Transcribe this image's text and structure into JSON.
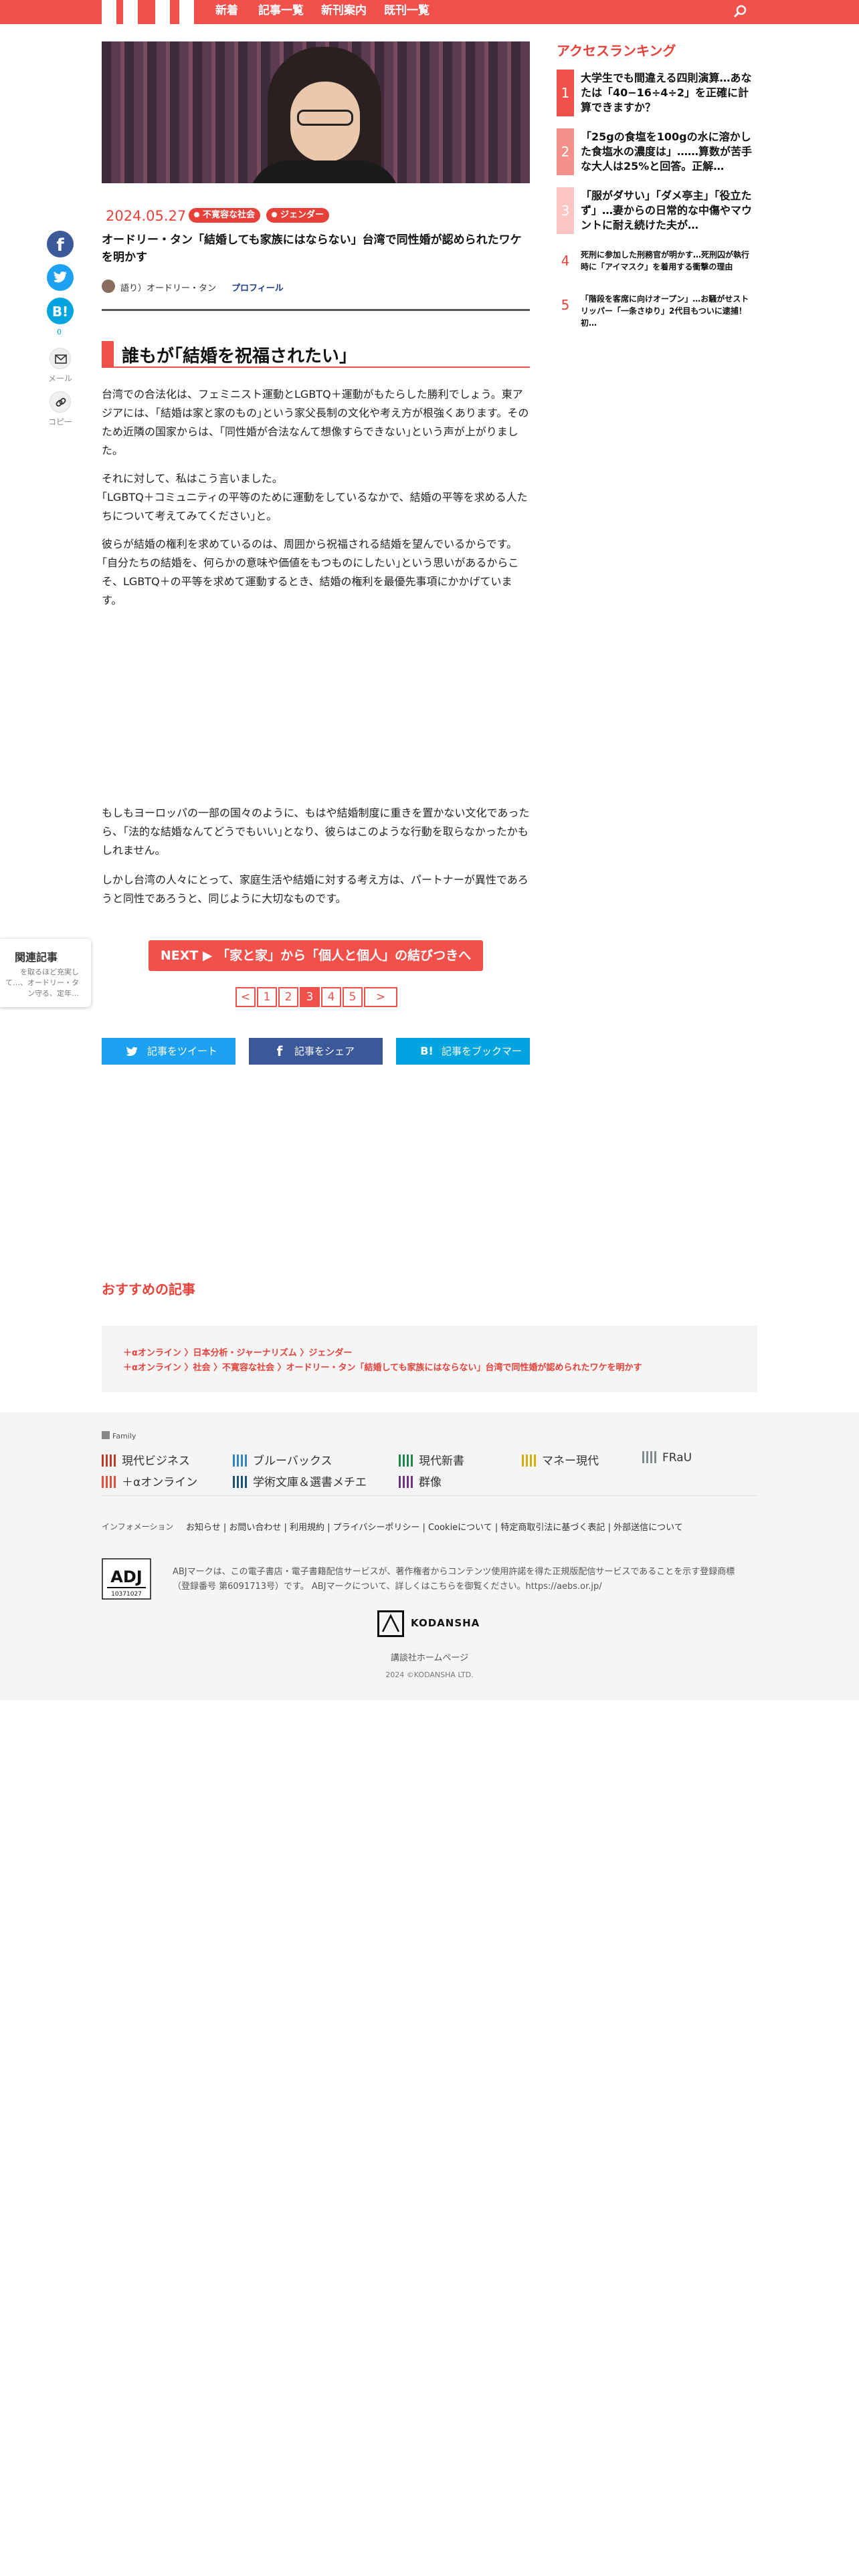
{
  "header": {
    "nav": [
      "新着",
      "記事一覧",
      "新刊案内",
      "既刊一覧"
    ]
  },
  "share_rail": {
    "hatena_count": "0",
    "mail_label": "メール",
    "copy_label": "コピー"
  },
  "related": {
    "title": "関連記事",
    "text": "を取るほど充実して…、オードリー・タン守る、定年…"
  },
  "article": {
    "date": "2024.05.27",
    "tags": [
      "不寛容な社会",
      "ジェンダー"
    ],
    "title": "オードリー・タン「結婚しても家族にはならない」台湾で同性婚が認められたワケを明かす",
    "author": "語り）オードリー・タン",
    "profile_label": "プロフィール",
    "heading": "誰もが｢結婚を祝福されたい｣",
    "paragraphs": [
      "台湾での合法化は、フェミニスト運動とLGBTQ＋運動がもたらした勝利でしょう。東アジアには、｢結婚は家と家のもの｣という家父長制の文化や考え方が根強くあります。そのため近隣の国家からは、｢同性婚が合法なんて想像すらできない｣という声が上がりました。",
      "それに対して、私はこう言いました。\n｢LGBTQ＋コミュニティの平等のために運動をしているなかで、結婚の平等を求める人たちについて考えてみてください｣と。",
      "彼らが結婚の権利を求めているのは、周囲から祝福される結婚を望んでいるからです。｢自分たちの結婚を、何らかの意味や価値をもつものにしたい｣という思いがあるからこそ、LGBTQ＋の平等を求めて運動するとき、結婚の権利を最優先事項にかかげています。",
      "もしもヨーロッパの一部の国々のように、もはや結婚制度に重きを置かない文化であったら、｢法的な結婚なんてどうでもいい｣となり、彼らはこのような行動を取らなかったかもしれません。",
      "しかし台湾の人々にとって、家庭生活や結婚に対する考え方は、パートナーが異性であろうと同性であろうと、同じように大切なものです。"
    ]
  },
  "next": {
    "label": "NEXT ▶ 「家と家」から「個人と個人」の結びつきへ"
  },
  "pagination": {
    "prev": "<",
    "pages": [
      "1",
      "2",
      "3",
      "4",
      "5"
    ],
    "current": "3",
    "next": ">"
  },
  "social": {
    "tweet": "記事をツイート",
    "share": "記事をシェア",
    "bookmark": "記事をブックマーク"
  },
  "recommended_heading": "おすすめの記事",
  "breadcrumbs": {
    "line1": "＋αオンライン 〉日本分析・ジャーナリズム 〉ジェンダー",
    "line2": "＋αオンライン 〉社会 〉不寛容な社会 〉オードリー・タン「結婚しても家族にはならない」台湾で同性婚が認められたワケを明かす"
  },
  "ranking": {
    "heading": "アクセスランキング",
    "items": [
      {
        "rank": "1",
        "text": "大学生でも間違える四則演算…あなたは「40−16÷4÷2」を正確に計算できますか？"
      },
      {
        "rank": "2",
        "text": "「25gの食塩を100gの水に溶かした食塩水の濃度は」……算数が苦手な大人は25%と回答。正解…"
      },
      {
        "rank": "3",
        "text": "「服がダサい」「ダメ亭主」「役立たず」…妻からの日常的な中傷やマウントに耐え続けた夫が…"
      },
      {
        "rank": "4",
        "text": "死刑に参加した刑務官が明かす…死刑囚が執行時に「アイマスク」を着用する衝撃の理由"
      },
      {
        "rank": "5",
        "text": "「階段を客席に向けオープン」…お騒がせストリッパー「一条さゆり」2代目もついに逮捕！初…"
      }
    ]
  },
  "footer": {
    "family_label": "Family",
    "family": [
      {
        "name": "現代ビジネス",
        "color": "#c0392b"
      },
      {
        "name": "ブルーバックス",
        "color": "#2e86c1"
      },
      {
        "name": "現代新書",
        "color": "#1e8449"
      },
      {
        "name": "マネー現代",
        "color": "#d4ac0d"
      },
      {
        "name": "FRaU",
        "color": "#7f8c8d"
      },
      {
        "name": "＋αオンライン",
        "color": "#e74c3c"
      },
      {
        "name": "学術文庫＆選書メチエ",
        "color": "#1a5276"
      },
      {
        "name": "群像",
        "color": "#6c3483"
      }
    ],
    "info_label": "インフォメーション",
    "links": "お知らせ | お問い合わせ | 利用規約 | プライバシーポリシー | Cookieについて | 特定商取引法に基づく表記 | 外部送信について",
    "adj_label": "ADJ",
    "adj_number": "10371027",
    "adj_text": "ABJマークは、この電子書店・電子書籍配信サービスが、著作権者からコンテンツ使用許諾を得た正規版配信サービスであることを示す登録商標（登録番号 第6091713号）です。 ABJマークについて、詳しくはこちらを御覧ください。https://aebs.or.jp/",
    "brand": "KODANSHA",
    "home": "講談社ホームページ",
    "copyright": "2024 ©KODANSHA LTD."
  }
}
